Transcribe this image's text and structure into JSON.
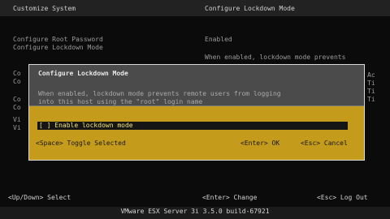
{
  "header": {
    "left_title": "Customize System",
    "right_title": "Configure Lockdown Mode"
  },
  "menu": {
    "items": [
      "Configure Root Password",
      "Configure Lockdown Mode"
    ],
    "side_letters": [
      "Co",
      "Co",
      "Co",
      "Co",
      "Vi",
      "Vi"
    ]
  },
  "right_panel": {
    "status": "Enabled",
    "help": "When enabled, lockdown mode prevents",
    "extra_lines": [
      "Ac",
      "Ti",
      "Ti",
      "Ti"
    ]
  },
  "dialog": {
    "title": "Configure Lockdown Mode",
    "description_line1": "When enabled, lockdown mode prevents remote users from logging",
    "description_line2": "into this host using the \"root\" login name",
    "option_label": "[ ] Enable lockdown mode",
    "hint_left": "<Space> Toggle Selected",
    "hint_ok": "<Enter> OK",
    "hint_cancel": "<Esc> Cancel"
  },
  "footer": {
    "left": "<Up/Down> Select",
    "middle": "<Enter> Change",
    "right": "<Esc> Log Out"
  },
  "status_bar": {
    "text": "VMware ESX Server 3i 3.5.0 build-67921"
  }
}
